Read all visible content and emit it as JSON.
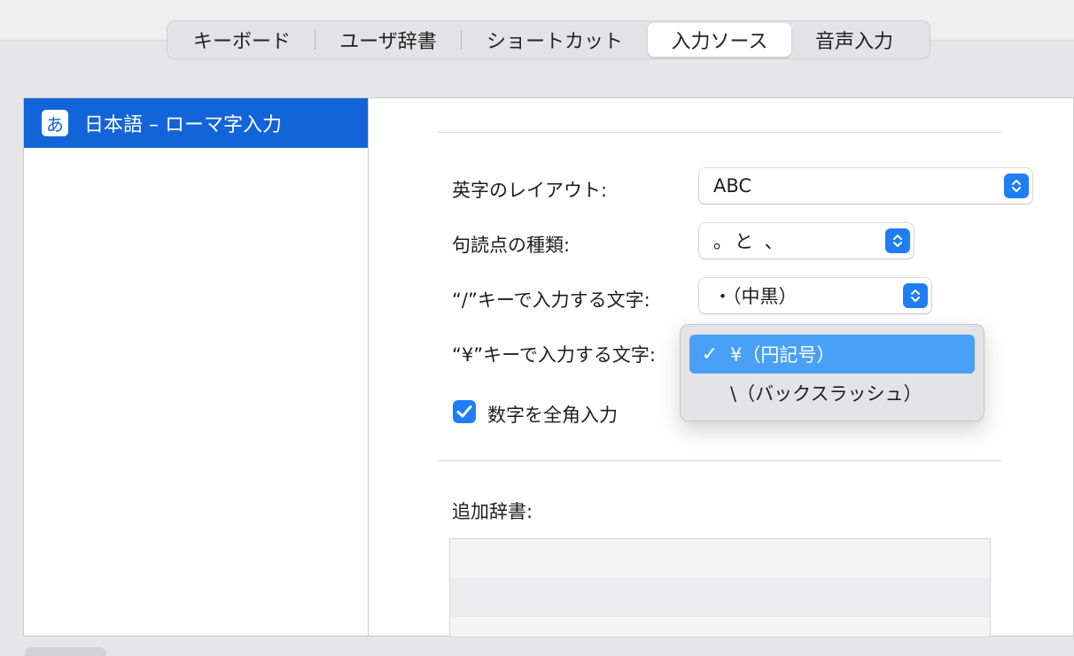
{
  "tabs": [
    {
      "label": "キーボード",
      "active": false
    },
    {
      "label": "ユーザ辞書",
      "active": false
    },
    {
      "label": "ショートカット",
      "active": false
    },
    {
      "label": "入力ソース",
      "active": true
    },
    {
      "label": "音声入力",
      "active": false
    }
  ],
  "sidebar": {
    "items": [
      {
        "icon_char": "あ",
        "label": "日本語 – ローマ字入力",
        "selected": true
      }
    ]
  },
  "settings": {
    "layout_label": "英字のレイアウト:",
    "layout_value": "ABC",
    "punct_label": "句読点の種類:",
    "punct_value": "。と 、",
    "slash_label": "“/”キーで入力する文字:",
    "slash_value": "・（中黒）",
    "yen_label": "“¥”キーで入力する文字:",
    "fullwidth_label": "数字を全角入力",
    "fullwidth_checked": true,
    "dict_label": "追加辞書:"
  },
  "dropdown": {
    "options": [
      {
        "check": "✓",
        "label": "¥（円記号）",
        "selected": true
      },
      {
        "check": "",
        "label": "\\（バックスラッシュ）",
        "selected": false
      }
    ]
  },
  "colors": {
    "accent": "#1f7df6",
    "sidebar_selected": "#1363d9",
    "menu_highlight": "#4aa0f7"
  }
}
